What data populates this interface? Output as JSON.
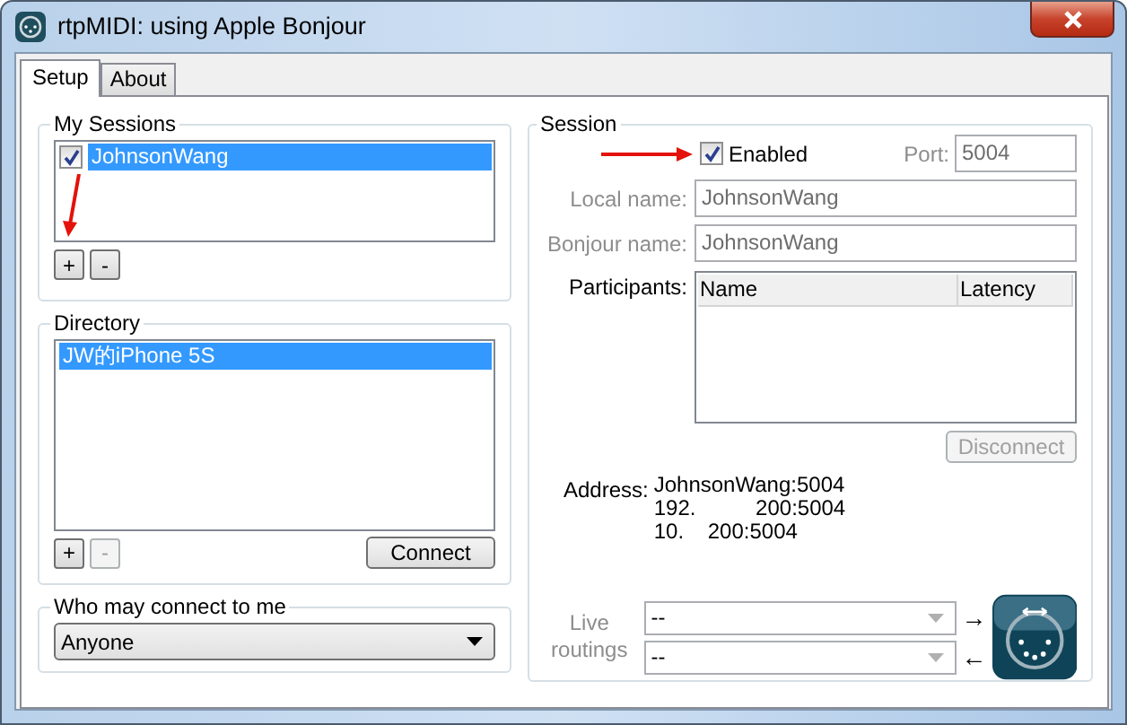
{
  "window": {
    "title": "rtpMIDI: using Apple Bonjour"
  },
  "tabs": [
    {
      "label": "Setup",
      "selected": true
    },
    {
      "label": "About",
      "selected": false
    }
  ],
  "my_sessions": {
    "title": "My Sessions",
    "items": [
      {
        "label": "JohnsonWang",
        "checked": true,
        "selected": true
      }
    ],
    "buttons": [
      {
        "label": "+",
        "disabled": false
      },
      {
        "label": "-",
        "disabled": false
      }
    ]
  },
  "directory": {
    "title": "Directory",
    "items": [
      {
        "label": "JW的iPhone 5S",
        "selected": true
      }
    ],
    "buttons": [
      {
        "label": "+",
        "disabled": false
      },
      {
        "label": "-",
        "disabled": true
      }
    ],
    "connect_button": {
      "label": "Connect",
      "disabled": false
    }
  },
  "who_may_connect": {
    "title": "Who may connect to me",
    "value": "Anyone"
  },
  "session": {
    "title": "Session",
    "enabled": {
      "label": "Enabled",
      "checked": true
    },
    "port": {
      "label": "Port:",
      "value": "5004",
      "disabled": true
    },
    "fields": [
      {
        "label": "Local name:",
        "value": "JohnsonWang",
        "disabled": true
      },
      {
        "label": "Bonjour name:",
        "value": "JohnsonWang",
        "disabled": true
      }
    ],
    "participants": {
      "label": "Participants:",
      "columns": [
        "Name",
        "Latency"
      ]
    },
    "disconnect_button": {
      "label": "Disconnect",
      "disabled": true
    },
    "address": {
      "label": "Address:",
      "lines": [
        "JohnsonWang:5004",
        "192.          200:5004",
        "10.    200:5004"
      ]
    },
    "live_routings": {
      "label": "Live routings",
      "disabled": true,
      "routes": [
        {
          "value": "--",
          "arrow": "→"
        },
        {
          "value": "--",
          "arrow": "←"
        }
      ]
    }
  }
}
